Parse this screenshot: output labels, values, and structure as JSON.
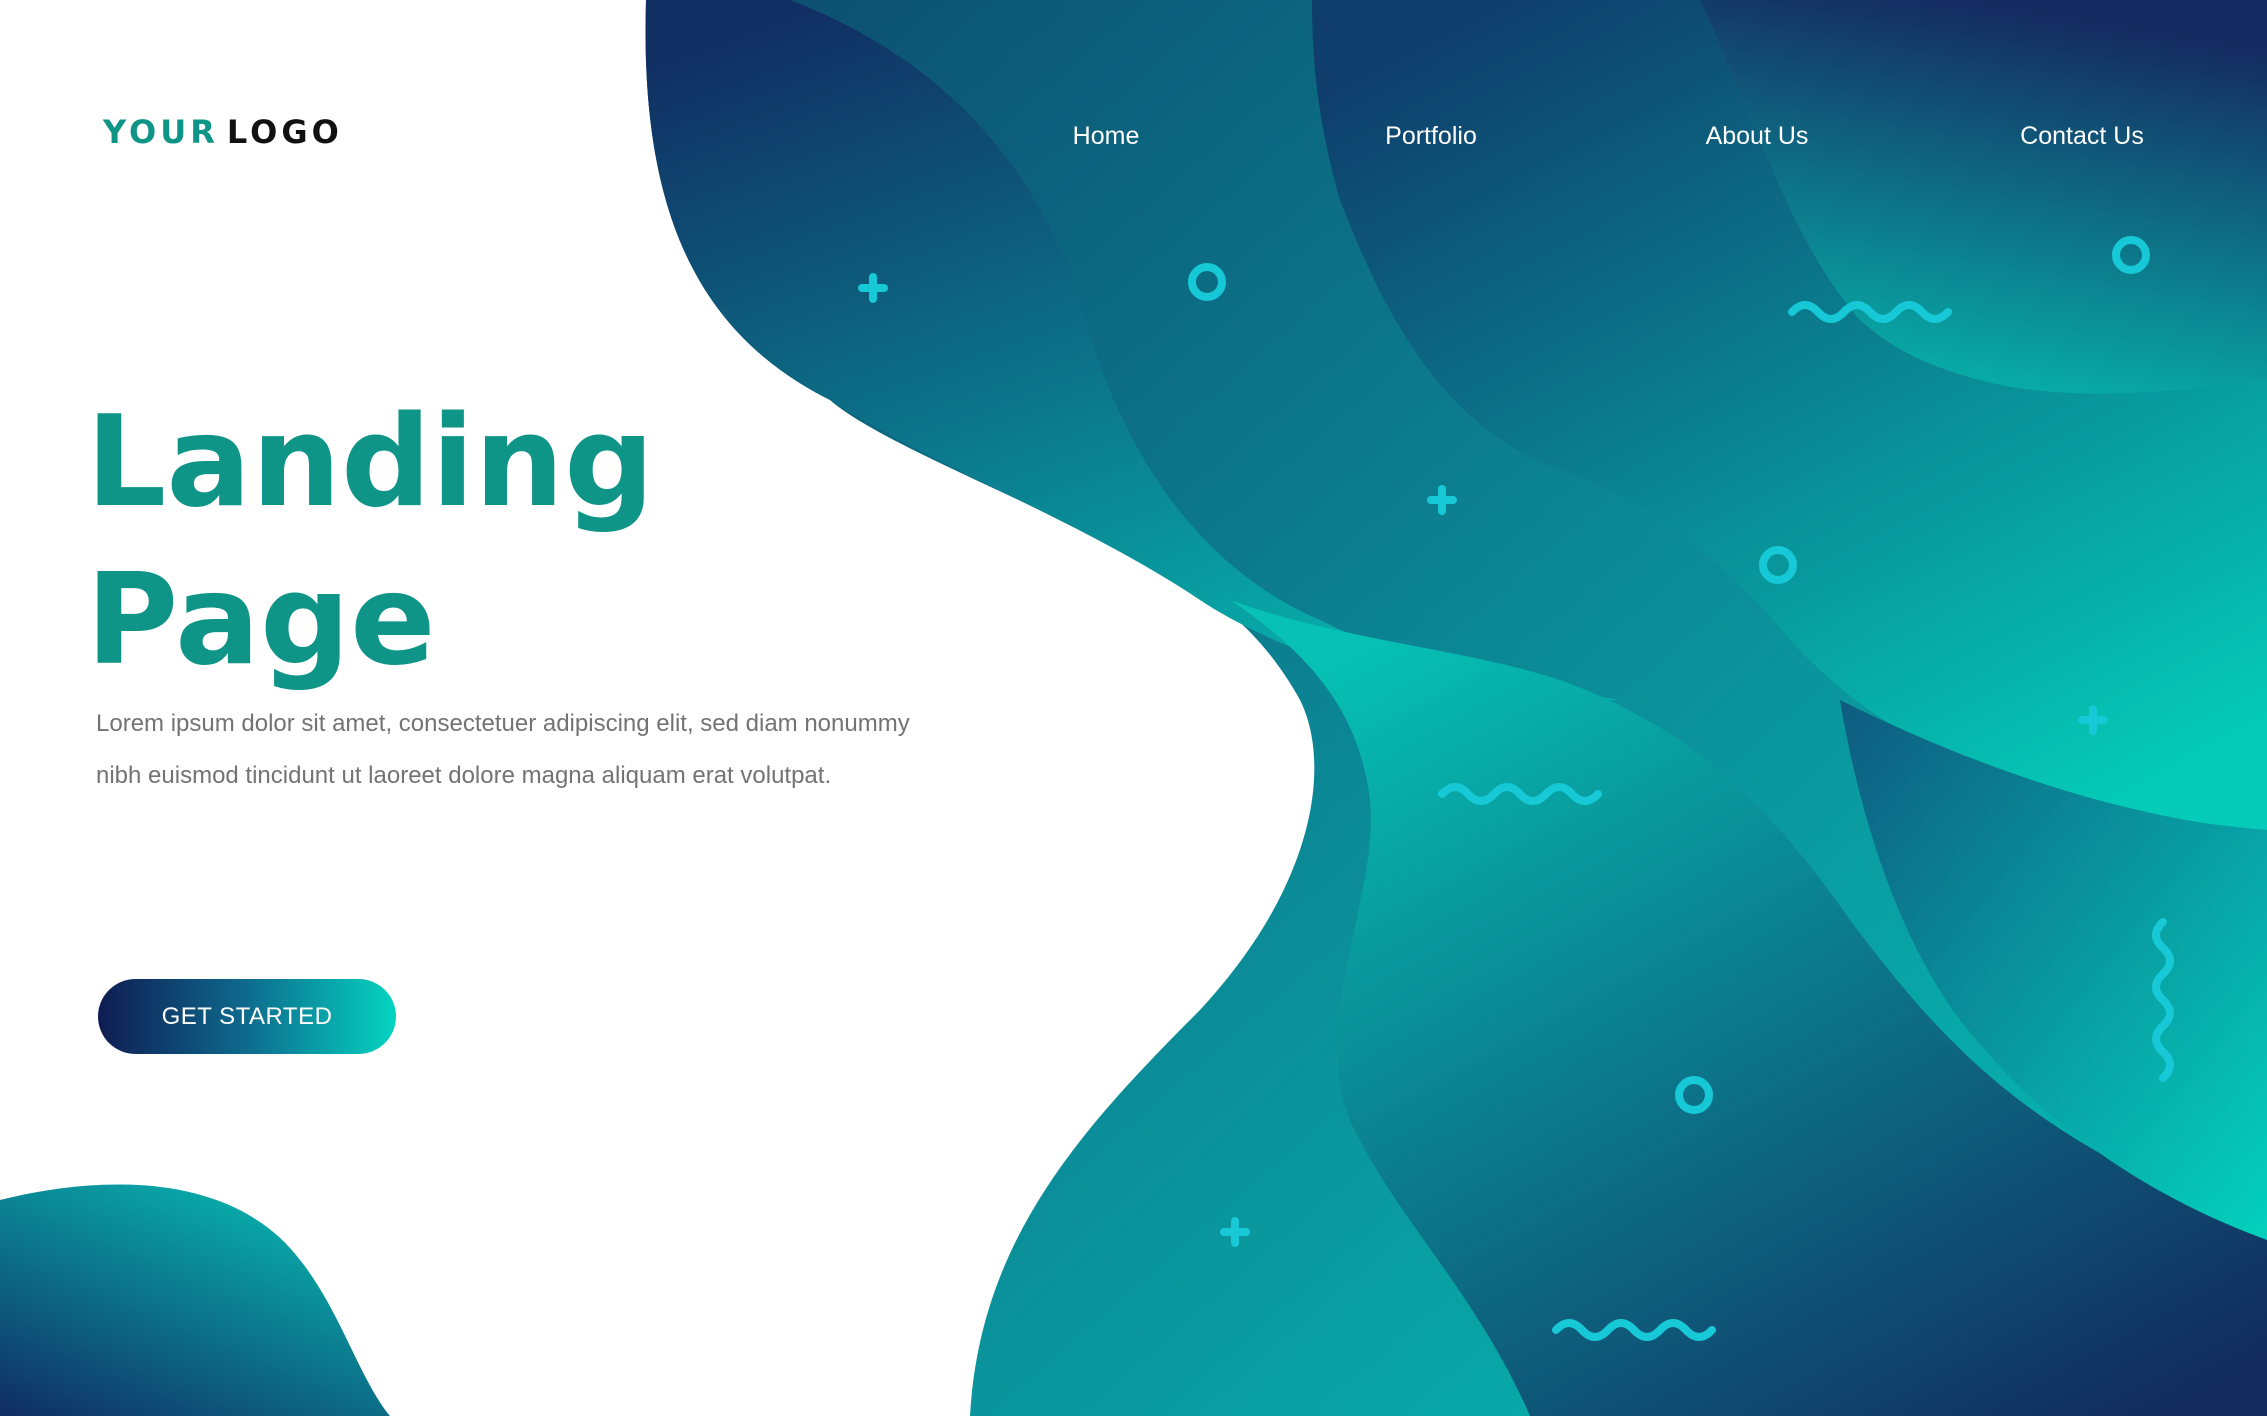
{
  "header": {
    "logo_part1": "YOUR",
    "logo_part2": "LOGO",
    "nav": [
      "Home",
      "Portfolio",
      "About Us",
      "Contact Us"
    ]
  },
  "hero": {
    "title": "Landing Page",
    "body": "Lorem ipsum dolor sit amet, consectetuer adipiscing elit, sed diam nonummy nibh euismod tincidunt ut laoreet dolore magna aliquam erat volutpat.",
    "cta_label": "GET STARTED"
  },
  "colors": {
    "primary": "#0f9488",
    "navy": "#0f1c52",
    "teal": "#04d4c0",
    "accent": "#17c9d6",
    "body_text": "#737373"
  },
  "decorations": [
    "plus-icon",
    "ring-icon",
    "wave-icon"
  ]
}
